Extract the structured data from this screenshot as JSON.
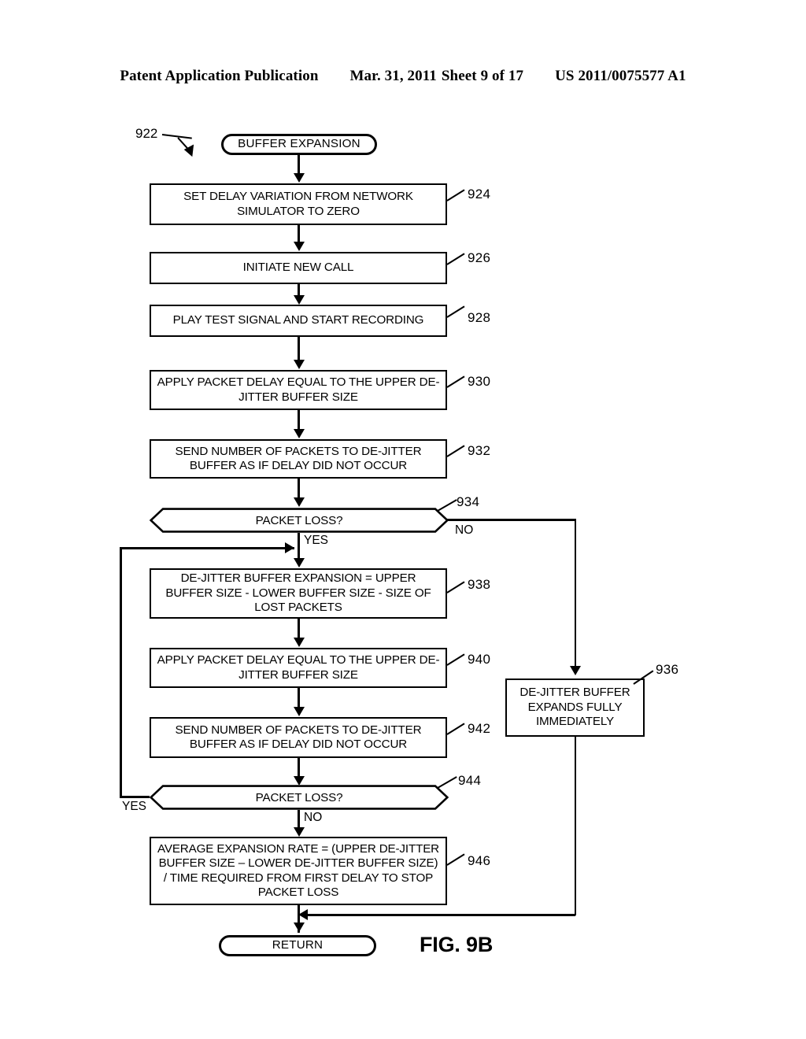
{
  "header": {
    "publication": "Patent Application Publication",
    "date": "Mar. 31, 2011",
    "sheet": "Sheet 9 of 17",
    "number": "US 2011/0075577 A1"
  },
  "figure": {
    "label": "FIG. 9B",
    "diagram_ref": "922"
  },
  "nodes": {
    "start": {
      "ref": "922",
      "text": "BUFFER EXPANSION"
    },
    "n924": {
      "ref": "924",
      "text": "SET DELAY VARIATION FROM NETWORK SIMULATOR TO ZERO"
    },
    "n926": {
      "ref": "926",
      "text": "INITIATE NEW CALL"
    },
    "n928": {
      "ref": "928",
      "text": "PLAY TEST SIGNAL AND START RECORDING"
    },
    "n930": {
      "ref": "930",
      "text": "APPLY PACKET DELAY EQUAL TO THE UPPER DE-JITTER BUFFER SIZE"
    },
    "n932": {
      "ref": "932",
      "text": "SEND NUMBER OF PACKETS TO DE-JITTER BUFFER AS IF DELAY DID NOT OCCUR"
    },
    "n934": {
      "ref": "934",
      "text": "PACKET LOSS?"
    },
    "n936": {
      "ref": "936",
      "text": "DE-JITTER BUFFER EXPANDS FULLY IMMEDIATELY"
    },
    "n938": {
      "ref": "938",
      "text": "DE-JITTER BUFFER EXPANSION = UPPER BUFFER SIZE - LOWER BUFFER SIZE - SIZE OF LOST PACKETS"
    },
    "n940": {
      "ref": "940",
      "text": "APPLY PACKET DELAY EQUAL TO THE UPPER DE-JITTER BUFFER SIZE"
    },
    "n942": {
      "ref": "942",
      "text": "SEND NUMBER OF PACKETS TO DE-JITTER BUFFER AS IF DELAY DID NOT OCCUR"
    },
    "n944": {
      "ref": "944",
      "text": "PACKET LOSS?"
    },
    "n946": {
      "ref": "946",
      "text": "AVERAGE EXPANSION RATE = (UPPER DE-JITTER BUFFER SIZE – LOWER DE-JITTER BUFFER SIZE) / TIME REQUIRED FROM FIRST DELAY TO STOP PACKET LOSS"
    },
    "end": {
      "text": "RETURN"
    }
  },
  "branches": {
    "b934_yes": "YES",
    "b934_no": "NO",
    "b944_yes": "YES",
    "b944_no": "NO"
  },
  "colors": {
    "ink": "#000000",
    "paper": "#ffffff"
  }
}
